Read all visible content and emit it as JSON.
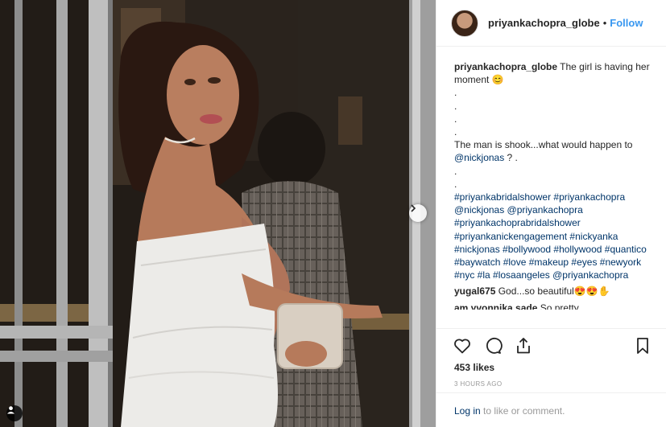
{
  "header": {
    "username": "priyankachopra_globe",
    "separator": "•",
    "follow_label": "Follow"
  },
  "caption": {
    "username": "priyankachopra_globe",
    "text_1": "The girl is having her moment",
    "emoji_1": "😊",
    "dot_lines": [
      ".",
      ".",
      ".",
      "."
    ],
    "text_2": "The man is shook...what would happen to",
    "mention_1": "@nickjonas",
    "text_2_end": " ? .",
    "dot_lines_2": [
      ".",
      "."
    ],
    "tags_text": "#priyankabridalshower #priyankachopra @nickjonas @priyankachopra #priyankachoprabridalshower #priyankanickengagement #nickyanka #nickjonas #bollywood #hollywood #quantico #baywatch #love #makeup #eyes #newyork #nyc #la #losaangeles @priyankachopra"
  },
  "comments": [
    {
      "username": "yugal675",
      "text": "God...so beautiful😍😍✋"
    },
    {
      "username": "am yvonnika sade",
      "text": "So pretty"
    }
  ],
  "actions": {
    "icons": [
      "heart-icon",
      "comment-icon",
      "share-icon",
      "bookmark-icon"
    ],
    "likes": "453 likes",
    "timestamp": "3 HOURS AGO"
  },
  "login": {
    "link_label": "Log in",
    "text": " to like or comment."
  },
  "colors": {
    "link": "#003569",
    "follow": "#3897f0",
    "muted": "#999999",
    "text": "#262626"
  }
}
